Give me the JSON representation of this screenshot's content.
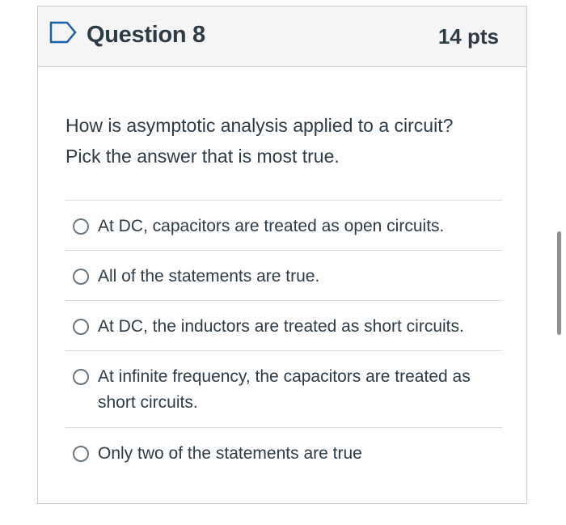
{
  "question": {
    "title": "Question 8",
    "points": "14 pts",
    "text_lines": [
      "How is asymptotic analysis applied to a circuit?",
      "Pick the answer that is most true."
    ],
    "flag_icon": "bookmark-flag-outline-icon"
  },
  "answers": [
    {
      "label": "At DC, capacitors are treated as open circuits.",
      "selected": false
    },
    {
      "label": "All of the statements are true.",
      "selected": false
    },
    {
      "label": "At DC, the inductors are treated as short circuits.",
      "selected": false
    },
    {
      "label": "At infinite frequency, the capacitors are treated as short circuits.",
      "selected": false
    },
    {
      "label": "Only two of the statements are true",
      "selected": false
    }
  ],
  "colors": {
    "flag_blue": "#1f5fa8",
    "header_bg": "#f5f5f5",
    "text": "#2d3b45",
    "border": "#c7cdd1",
    "radio_border": "#6b7780",
    "scrollbar": "#8e8e93"
  }
}
